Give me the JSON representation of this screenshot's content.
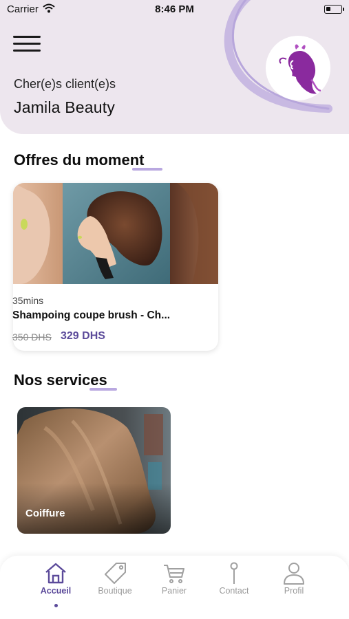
{
  "status_bar": {
    "carrier": "Carrier",
    "time": "8:46 PM",
    "battery_level": 0.3
  },
  "header": {
    "greeting": "Cher(e)s client(e)s",
    "salon_name": "Jamila Beauty",
    "menu_icon": "hamburger-menu-icon",
    "logo_icon": "woman-silhouette-logo",
    "background_color": "#ede6ee"
  },
  "offers": {
    "title": "Offres du moment",
    "items": [
      {
        "duration": "35mins",
        "name": "Shampoing coupe brush - Ch...",
        "old_price": "350 DHS",
        "new_price": "329 DHS"
      }
    ]
  },
  "services": {
    "title": "Nos services",
    "items": [
      {
        "label": "Coiffure"
      }
    ]
  },
  "bottom_nav": {
    "items": [
      {
        "label": "Accueil",
        "icon": "home-icon",
        "active": true
      },
      {
        "label": "Boutique",
        "icon": "tag-icon",
        "active": false
      },
      {
        "label": "Panier",
        "icon": "cart-icon",
        "active": false
      },
      {
        "label": "Contact",
        "icon": "location-pin-icon",
        "active": false
      },
      {
        "label": "Profil",
        "icon": "user-icon",
        "active": false
      }
    ]
  },
  "colors": {
    "accent": "#5b4a9a",
    "accent_light": "#b9a8e0",
    "header_bg": "#ede6ee",
    "logo_purple": "#8a2a9e"
  }
}
